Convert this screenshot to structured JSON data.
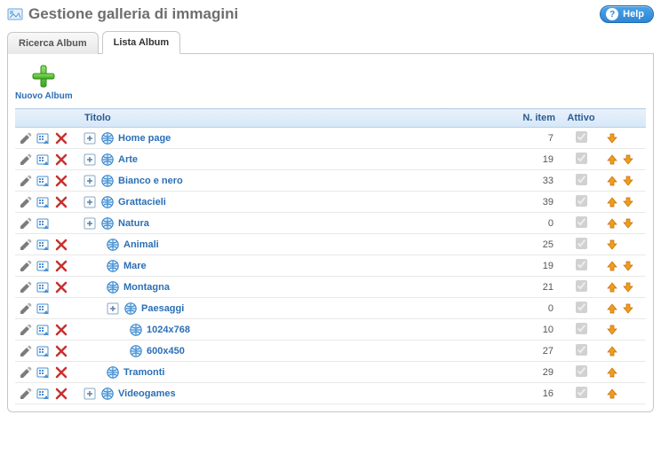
{
  "header": {
    "title": "Gestione galleria di immagini",
    "help_label": "Help"
  },
  "tabs": {
    "search": "Ricerca Album",
    "list": "Lista Album"
  },
  "toolbar": {
    "new_album": "Nuovo Album"
  },
  "columns": {
    "title": "Titolo",
    "n_item": "N. item",
    "active": "Attivo"
  },
  "rows": [
    {
      "title": "Home page",
      "n_item": 7,
      "active": true,
      "indent": 0,
      "edit": true,
      "palette": true,
      "del": true,
      "expand": true,
      "up": false,
      "down": true
    },
    {
      "title": "Arte",
      "n_item": 19,
      "active": true,
      "indent": 0,
      "edit": true,
      "palette": true,
      "del": true,
      "expand": true,
      "up": true,
      "down": true
    },
    {
      "title": "Bianco e nero",
      "n_item": 33,
      "active": true,
      "indent": 0,
      "edit": true,
      "palette": true,
      "del": true,
      "expand": true,
      "up": true,
      "down": true
    },
    {
      "title": "Grattacieli",
      "n_item": 39,
      "active": true,
      "indent": 0,
      "edit": true,
      "palette": true,
      "del": true,
      "expand": true,
      "up": true,
      "down": true
    },
    {
      "title": "Natura",
      "n_item": 0,
      "active": true,
      "indent": 0,
      "edit": true,
      "palette": true,
      "del": false,
      "expand": true,
      "up": true,
      "down": true
    },
    {
      "title": "Animali",
      "n_item": 25,
      "active": true,
      "indent": 1,
      "edit": true,
      "palette": true,
      "del": true,
      "expand": false,
      "up": false,
      "down": true
    },
    {
      "title": "Mare",
      "n_item": 19,
      "active": true,
      "indent": 1,
      "edit": true,
      "palette": true,
      "del": true,
      "expand": false,
      "up": true,
      "down": true
    },
    {
      "title": "Montagna",
      "n_item": 21,
      "active": true,
      "indent": 1,
      "edit": true,
      "palette": true,
      "del": true,
      "expand": false,
      "up": true,
      "down": true
    },
    {
      "title": "Paesaggi",
      "n_item": 0,
      "active": true,
      "indent": 1,
      "edit": true,
      "palette": true,
      "del": false,
      "expand": true,
      "up": true,
      "down": true
    },
    {
      "title": "1024x768",
      "n_item": 10,
      "active": true,
      "indent": 2,
      "edit": true,
      "palette": true,
      "del": true,
      "expand": false,
      "up": false,
      "down": true
    },
    {
      "title": "600x450",
      "n_item": 27,
      "active": true,
      "indent": 2,
      "edit": true,
      "palette": true,
      "del": true,
      "expand": false,
      "up": true,
      "down": false
    },
    {
      "title": "Tramonti",
      "n_item": 29,
      "active": true,
      "indent": 1,
      "edit": true,
      "palette": true,
      "del": true,
      "expand": false,
      "up": true,
      "down": false
    },
    {
      "title": "Videogames",
      "n_item": 16,
      "active": true,
      "indent": 0,
      "edit": true,
      "palette": true,
      "del": true,
      "expand": true,
      "up": true,
      "down": false
    }
  ]
}
